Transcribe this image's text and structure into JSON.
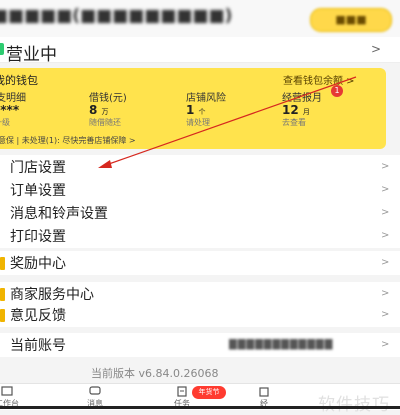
{
  "header": {
    "store_name": "■■■■■(■■■■■■■■■)",
    "switch_label": "■■■"
  },
  "status": {
    "label": "营业中",
    "arrow": ">"
  },
  "wallet": {
    "title": "我的钱包",
    "link": "查看钱包余额 >",
    "columns": [
      {
        "label": "收支明细",
        "value": "****",
        "sub": "去升级"
      },
      {
        "label": "借钱(元)",
        "value": "8",
        "unit": "万",
        "sub": "随借随还"
      },
      {
        "label": "店铺风险",
        "value": "1",
        "unit": "个",
        "sub": "请处理"
      },
      {
        "label": "经营报月",
        "value": "12",
        "unit": "月",
        "sub": "去查看",
        "badge": "1"
      }
    ],
    "notice": "注意保 | 未处理(1): 尽快完善店铺保障 >"
  },
  "menu": [
    {
      "label": "门店设置",
      "arrow": ">"
    },
    {
      "label": "订单设置",
      "arrow": ">"
    },
    {
      "label": "消息和铃声设置",
      "arrow": ">"
    },
    {
      "label": "打印设置",
      "arrow": ">"
    },
    {
      "label": "奖励中心",
      "arrow": ">"
    },
    {
      "label": "商家服务中心",
      "arrow": ">"
    },
    {
      "label": "意见反馈",
      "arrow": ">"
    },
    {
      "label": "当前账号",
      "value": "████████████",
      "arrow": ">"
    }
  ],
  "version": "当前版本 v6.84.0.26068",
  "tabbar": {
    "tabs": [
      "工作台",
      "消息",
      "任务",
      "经"
    ],
    "badge": "年货节",
    "watermark": "软件技巧"
  }
}
